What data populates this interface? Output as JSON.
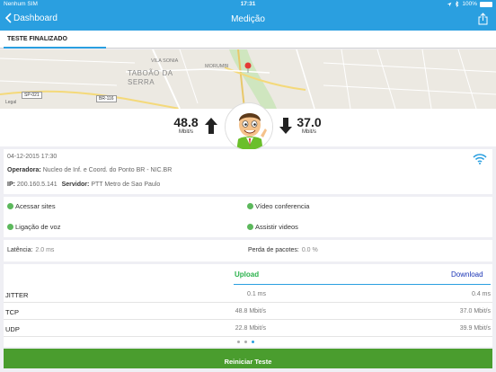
{
  "status_bar": {
    "carrier": "Nenhum SIM",
    "time": "17:31",
    "battery": "100%"
  },
  "navbar": {
    "back_label": "Dashboard",
    "title": "Medição"
  },
  "tabs": [
    {
      "label": "TESTE FINALIZADO",
      "active": true
    }
  ],
  "map": {
    "labels": [
      "VILA SONIA",
      "MORUMBI",
      "TABOÃO DA SERRA",
      "SP-021",
      "BR-116",
      "Legal"
    ]
  },
  "results": {
    "download_value": "48.8",
    "download_unit": "Mbit/s",
    "upload_value": "37.0",
    "upload_unit": "Mbit/s"
  },
  "info": {
    "datetime": "04-12-2015 17:30",
    "operator_label": "Operadora:",
    "operator_value": "Nucleo de Inf. e Coord. do Ponto BR - NIC.BR",
    "ip_label": "IP:",
    "ip_value": "200.160.5.141",
    "server_label": "Servidor:",
    "server_value": "PTT Metro de Sao Paulo"
  },
  "services": [
    "Acessar sites",
    "Vídeo conferencia",
    "Ligação de voz",
    "Assistir videos"
  ],
  "stats": {
    "latency_label": "Latência:",
    "latency_value": "2.0 ms",
    "loss_label": "Perda de pacotes:",
    "loss_value": "0.0 %"
  },
  "table": {
    "upload_header": "Upload",
    "download_header": "Download",
    "rows": [
      {
        "label": "JITTER",
        "upload": "0.1 ms",
        "download": "0.4 ms"
      },
      {
        "label": "TCP",
        "upload": "48.8 Mbit/s",
        "download": "37.0 Mbit/s"
      },
      {
        "label": "UDP",
        "upload": "22.8 Mbit/s",
        "download": "39.9 Mbit/s"
      }
    ]
  },
  "pager": {
    "pages": 3,
    "active": 3
  },
  "restart_label": "Reiniciar Teste",
  "colors": {
    "accent": "#2a9fe0",
    "upload": "#2bb24c",
    "download": "#1a34b5",
    "button": "#4a9d2e",
    "ok": "#5cb85c"
  }
}
